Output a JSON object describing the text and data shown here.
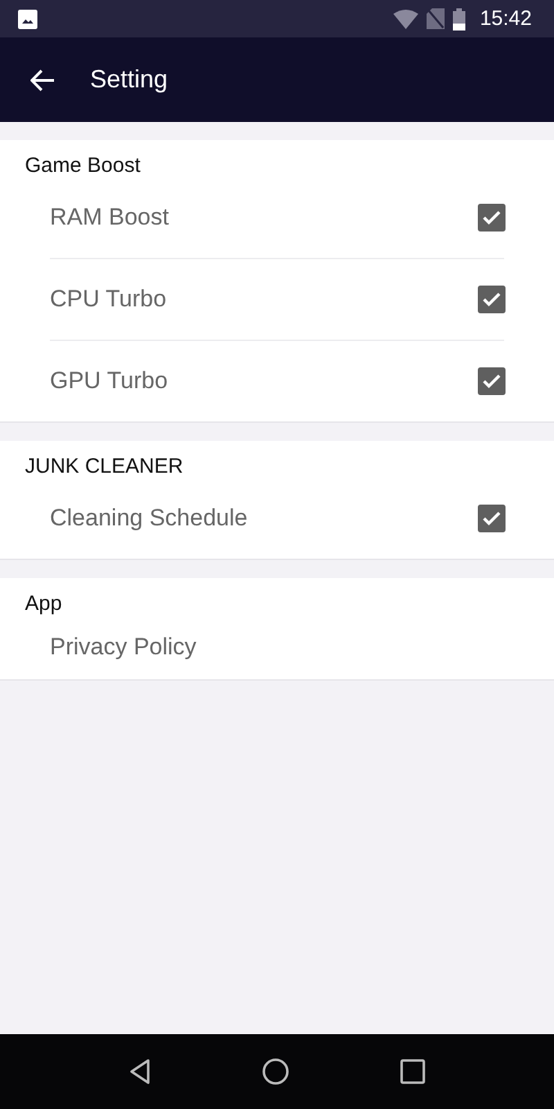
{
  "status_bar": {
    "time": "15:42"
  },
  "toolbar": {
    "title": "Setting"
  },
  "sections": [
    {
      "title": "Game Boost",
      "items": [
        {
          "kind": "checkbox",
          "label": "RAM Boost",
          "checked": true
        },
        {
          "kind": "checkbox",
          "label": "CPU Turbo",
          "checked": true
        },
        {
          "kind": "checkbox",
          "label": "GPU Turbo",
          "checked": true
        }
      ]
    },
    {
      "title": "JUNK CLEANER",
      "items": [
        {
          "kind": "checkbox",
          "label": "Cleaning Schedule",
          "checked": true
        }
      ]
    },
    {
      "title": "App",
      "items": [
        {
          "kind": "link",
          "label": "Privacy Policy"
        }
      ]
    }
  ]
}
